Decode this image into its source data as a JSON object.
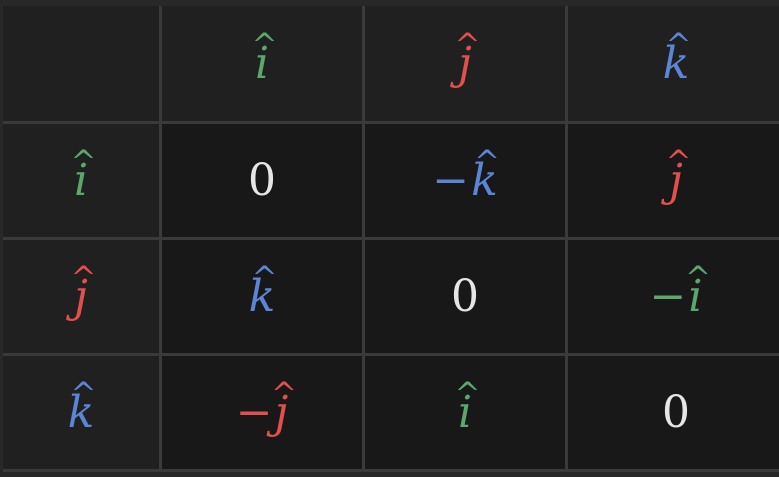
{
  "colors": {
    "i": "#5aa86b",
    "j": "#e0504c",
    "k": "#5b86d6",
    "zero": "#e6e6e6"
  },
  "hat": "^",
  "column_headers": [
    {
      "text": "",
      "basis": ""
    },
    {
      "text": "i",
      "basis": "i"
    },
    {
      "text": "j",
      "basis": "j"
    },
    {
      "text": "k",
      "basis": "k"
    }
  ],
  "rows": [
    {
      "label": {
        "text": "i",
        "basis": "i"
      },
      "cells": [
        {
          "sign": "",
          "text": "0",
          "basis": "zero"
        },
        {
          "sign": "−",
          "text": "k",
          "basis": "k"
        },
        {
          "sign": "",
          "text": "j",
          "basis": "j"
        }
      ]
    },
    {
      "label": {
        "text": "j",
        "basis": "j"
      },
      "cells": [
        {
          "sign": "",
          "text": "k",
          "basis": "k"
        },
        {
          "sign": "",
          "text": "0",
          "basis": "zero"
        },
        {
          "sign": "−",
          "text": "i",
          "basis": "i"
        }
      ]
    },
    {
      "label": {
        "text": "k",
        "basis": "k"
      },
      "cells": [
        {
          "sign": "−",
          "text": "j",
          "basis": "j"
        },
        {
          "sign": "",
          "text": "i",
          "basis": "i"
        },
        {
          "sign": "",
          "text": "0",
          "basis": "zero"
        }
      ]
    }
  ]
}
